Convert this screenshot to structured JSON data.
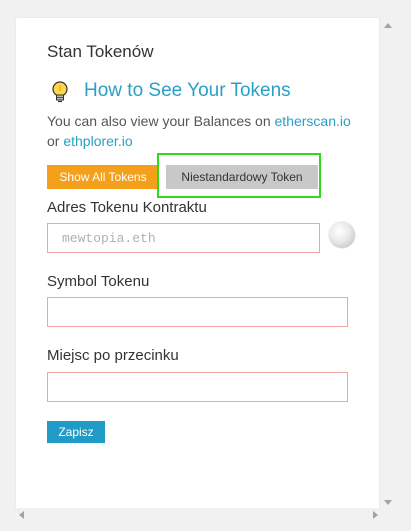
{
  "panel": {
    "title": "Stan Tokenów",
    "how_to_link": "How to See Your Tokens",
    "description": {
      "text_before": "You can also view your Balances on ",
      "link1": "etherscan.io",
      "text_or": "or ",
      "link2": "ethplorer.io"
    },
    "tabs": {
      "show_all": "Show All Tokens",
      "custom": "Niestandardowy Token"
    },
    "fields": {
      "address_label": "Adres Tokenu Kontraktu",
      "address_placeholder": "mewtopia.eth",
      "symbol_label": "Symbol Tokenu",
      "symbol_value": "",
      "decimals_label": "Miejsc po przecinku",
      "decimals_value": ""
    },
    "save_button": "Zapisz"
  },
  "colors": {
    "accent_link": "#2a9fc7",
    "show_all_bg": "#f5a01a",
    "save_bg": "#1f9bc5",
    "highlight_border": "#2fd91f",
    "field_border": "#f0a5a5"
  },
  "icons": {
    "bulb": "lightbulb-icon",
    "identicon": "address-identicon"
  }
}
